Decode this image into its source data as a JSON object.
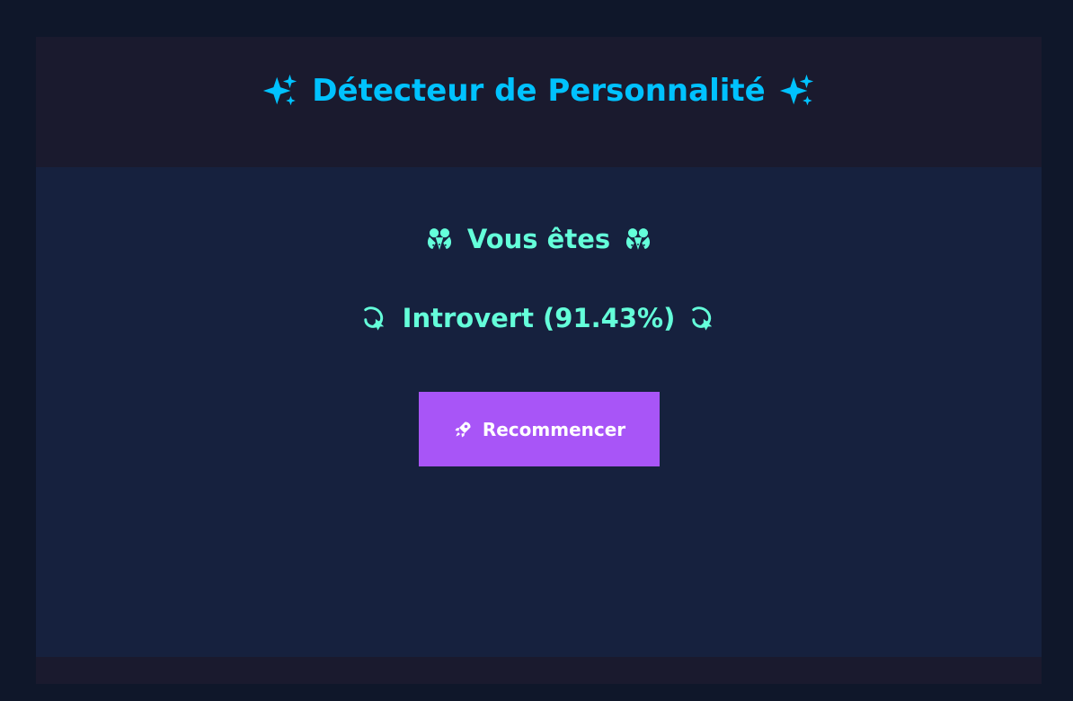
{
  "header": {
    "title": "Détecteur de Personnalité",
    "left_icon": "sparkles-icon",
    "right_icon": "sparkles-icon"
  },
  "result": {
    "heading": "Vous êtes",
    "heading_left_icon": "fairy-icon",
    "heading_right_icon": "fairy-icon",
    "label": "Introvert (91.43%)",
    "label_left_icon": "dizzy-icon",
    "label_right_icon": "dizzy-icon",
    "probability_percent": 91.43
  },
  "actions": {
    "restart_label": "Recommencer",
    "restart_icon": "rocket-icon"
  },
  "colors": {
    "page_background": "#0f172a",
    "frame_background": "#1a1a2e",
    "content_background": "#16213e",
    "title": "#00c2ff",
    "result_text": "#64ffda",
    "button": "#a855f7",
    "button_text": "#ffffff"
  }
}
